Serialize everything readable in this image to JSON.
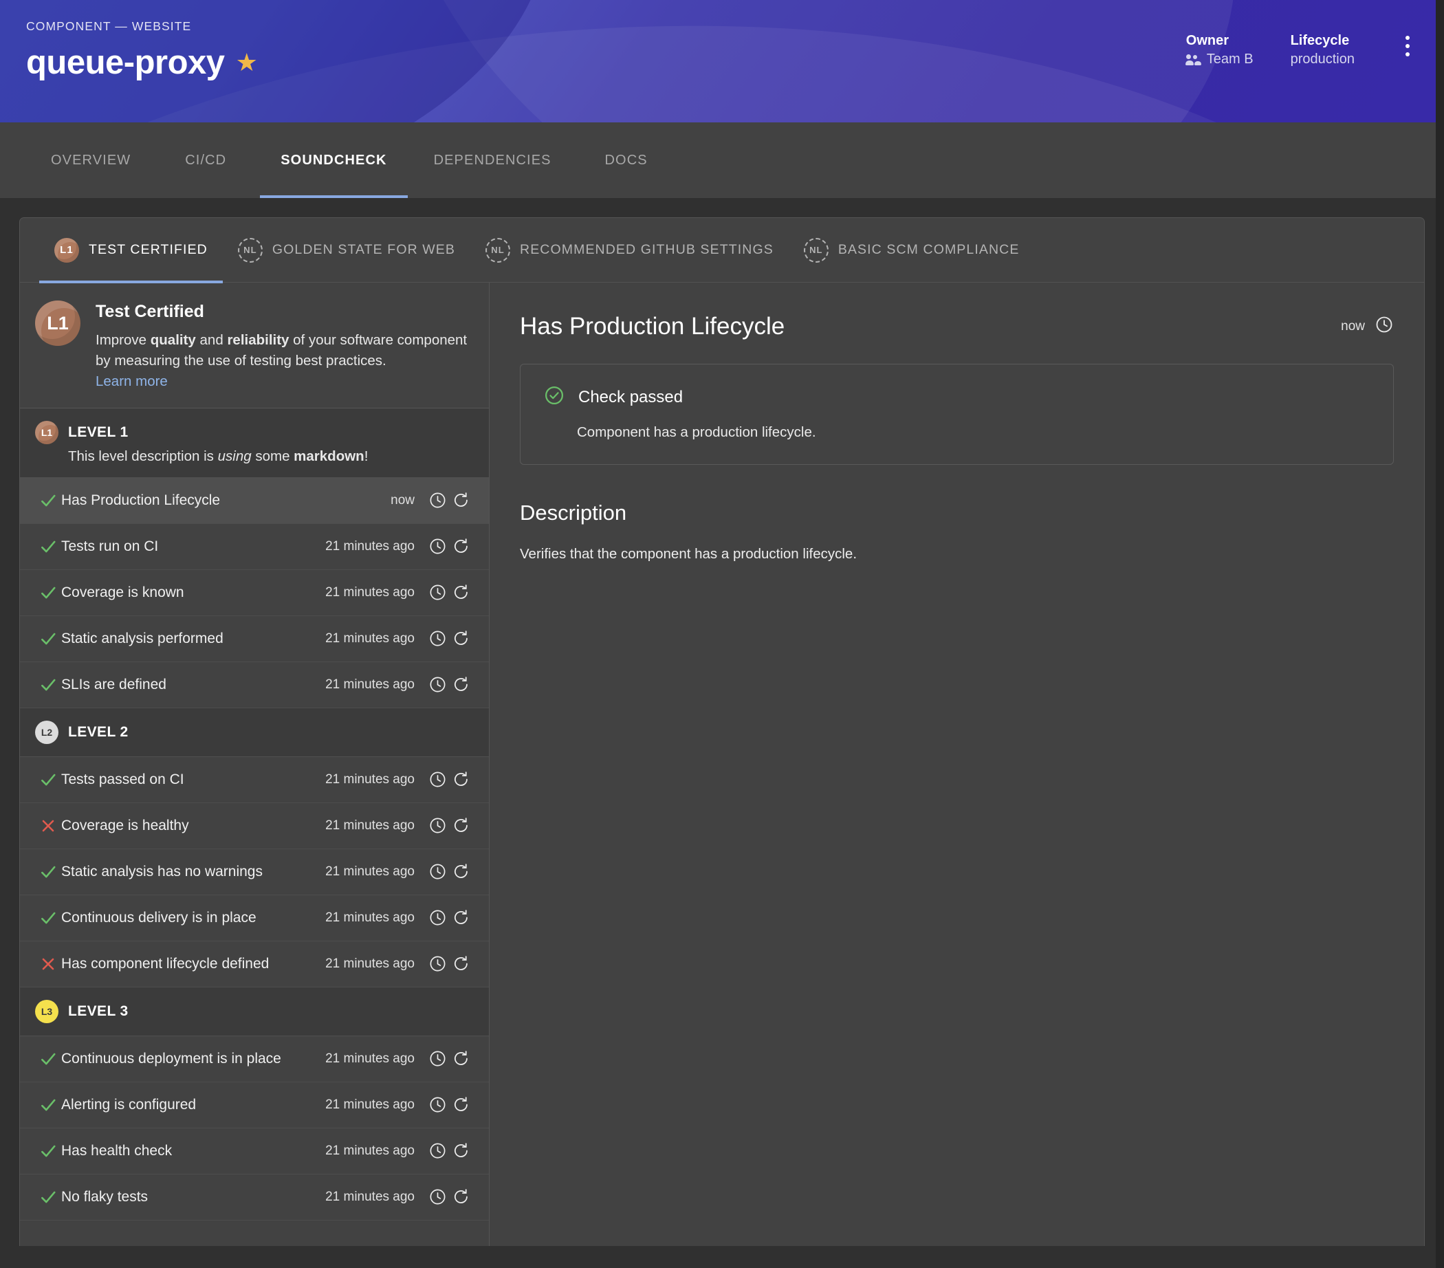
{
  "banner": {
    "breadcrumb": "COMPONENT — WEBSITE",
    "title": "queue-proxy",
    "star_icon": "★",
    "owner_label": "Owner",
    "owner_value": "Team B",
    "lifecycle_label": "Lifecycle",
    "lifecycle_value": "production"
  },
  "main_tabs": [
    {
      "label": "OVERVIEW",
      "active": false
    },
    {
      "label": "CI/CD",
      "active": false
    },
    {
      "label": "SOUNDCHECK",
      "active": true
    },
    {
      "label": "DEPENDENCIES",
      "active": false
    },
    {
      "label": "DOCS",
      "active": false
    }
  ],
  "cert_tabs": [
    {
      "badge": "L1",
      "badge_kind": "l1",
      "label": "TEST CERTIFIED",
      "active": true
    },
    {
      "badge": "NL",
      "badge_kind": "nl",
      "label": "GOLDEN STATE FOR WEB",
      "active": false
    },
    {
      "badge": "NL",
      "badge_kind": "nl",
      "label": "RECOMMENDED GITHUB SETTINGS",
      "active": false
    },
    {
      "badge": "NL",
      "badge_kind": "nl",
      "label": "BASIC SCM COMPLIANCE",
      "active": false
    }
  ],
  "sidebar": {
    "avatar_badge": "L1",
    "title": "Test Certified",
    "description_html": "Improve <b>quality</b> and <b>reliability</b> of your software component by measuring the use of testing best practices.",
    "learn_more": "Learn more",
    "levels": [
      {
        "badge": "L1",
        "badge_kind": "l1",
        "title": "LEVEL 1",
        "description_html": "This level description is <i>using</i> some <b>markdown</b>!",
        "checks": [
          {
            "label": "Has Production Lifecycle",
            "status": "pass",
            "time": "now",
            "selected": true
          },
          {
            "label": "Tests run on CI",
            "status": "pass",
            "time": "21 minutes ago",
            "selected": false
          },
          {
            "label": "Coverage is known",
            "status": "pass",
            "time": "21 minutes ago",
            "selected": false
          },
          {
            "label": "Static analysis performed",
            "status": "pass",
            "time": "21 minutes ago",
            "selected": false
          },
          {
            "label": "SLIs are defined",
            "status": "pass",
            "time": "21 minutes ago",
            "selected": false
          }
        ]
      },
      {
        "badge": "L2",
        "badge_kind": "l2",
        "title": "LEVEL 2",
        "description_html": "",
        "checks": [
          {
            "label": "Tests passed on CI",
            "status": "pass",
            "time": "21 minutes ago",
            "selected": false
          },
          {
            "label": "Coverage is healthy",
            "status": "fail",
            "time": "21 minutes ago",
            "selected": false
          },
          {
            "label": "Static analysis has no warnings",
            "status": "pass",
            "time": "21 minutes ago",
            "selected": false
          },
          {
            "label": "Continuous delivery is in place",
            "status": "pass",
            "time": "21 minutes ago",
            "selected": false
          },
          {
            "label": "Has component lifecycle defined",
            "status": "fail",
            "time": "21 minutes ago",
            "selected": false
          }
        ]
      },
      {
        "badge": "L3",
        "badge_kind": "l3",
        "title": "LEVEL 3",
        "description_html": "",
        "checks": [
          {
            "label": "Continuous deployment is in place",
            "status": "pass",
            "time": "21 minutes ago",
            "selected": false
          },
          {
            "label": "Alerting is configured",
            "status": "pass",
            "time": "21 minutes ago",
            "selected": false
          },
          {
            "label": "Has health check",
            "status": "pass",
            "time": "21 minutes ago",
            "selected": false
          },
          {
            "label": "No flaky tests",
            "status": "pass",
            "time": "21 minutes ago",
            "selected": false
          }
        ]
      }
    ]
  },
  "detail": {
    "title": "Has Production Lifecycle",
    "time": "now",
    "result_status": "pass",
    "result_title": "Check passed",
    "result_message": "Component has a production lifecycle.",
    "section_title": "Description",
    "section_body": "Verifies that the component has a production lifecycle."
  },
  "colors": {
    "accent": "#88a8e0",
    "pass": "#6abf69",
    "fail": "#e05a4e",
    "link": "#8fb4e8",
    "star": "#f0b849",
    "level1": "#a8745a",
    "level2": "#dcdcdc",
    "level3": "#f4e04d",
    "banner_from": "#3d4bbf",
    "banner_to": "#2d1ea3"
  },
  "icons": {
    "history": "history-clock-icon",
    "refresh": "refresh-icon",
    "kebab": "more-vertical-icon",
    "people": "people-icon",
    "check": "check-icon",
    "cross": "cross-icon",
    "check-circle": "check-circle-icon"
  }
}
